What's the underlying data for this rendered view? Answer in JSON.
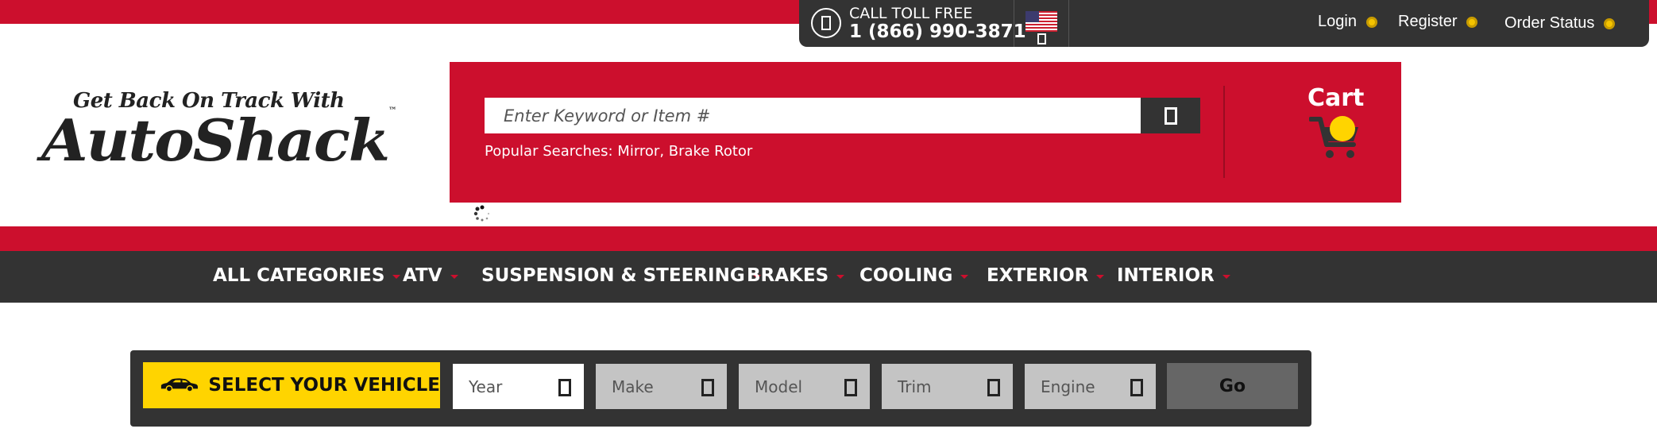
{
  "utility": {
    "toll_label": "CALL TOLL FREE",
    "toll_number": "1 (866) 990-3871",
    "links": [
      "Login",
      "Register",
      "Order Status"
    ]
  },
  "logo": {
    "tagline": "Get Back On Track With",
    "brand": "AutoShack",
    "tm": "™"
  },
  "search": {
    "placeholder": "Enter Keyword or Item #",
    "popular": "Popular Searches: Mirror, Brake Rotor"
  },
  "cart": {
    "label": "Cart"
  },
  "nav": {
    "items": [
      "ALL CATEGORIES",
      "ATV",
      "SUSPENSION & STEERING",
      "BRAKES",
      "COOLING",
      "EXTERIOR",
      "INTERIOR"
    ]
  },
  "vehicle": {
    "title": "SELECT YOUR VEHICLE",
    "selects": [
      "Year",
      "Make",
      "Model",
      "Trim",
      "Engine"
    ],
    "go_label": "Go"
  },
  "colors": {
    "brand_red": "#cc0f2d",
    "dark": "#333333",
    "accent_yellow": "#ffd400"
  },
  "icons": [
    "phone-icon",
    "us-flag-icon",
    "search-icon",
    "cart-icon",
    "car-icon",
    "loading-spinner-icon",
    "chevron-down-icon"
  ]
}
